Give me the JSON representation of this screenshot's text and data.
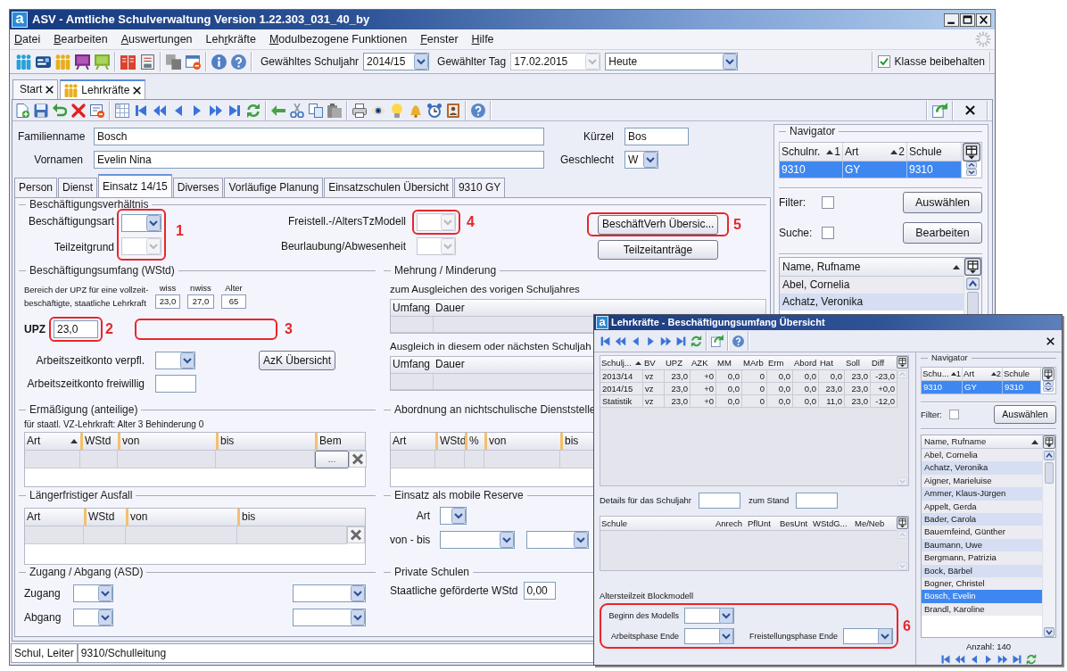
{
  "window": {
    "logo": "a",
    "title": "ASV - Amtliche Schulverwaltung Version 1.22.303_031_40_by"
  },
  "menu": [
    {
      "key": "D",
      "rest": "atei"
    },
    {
      "key": "B",
      "rest": "earbeiten"
    },
    {
      "key": "A",
      "rest": "uswertungen"
    },
    {
      "lead": "Leh",
      "key": "r",
      "rest": "kräfte"
    },
    {
      "key": "M",
      "rest": "odulbezogene Funktionen"
    },
    {
      "key": "F",
      "rest": "enster"
    },
    {
      "key": "H",
      "rest": "ilfe"
    }
  ],
  "toolbar": {
    "school_year": {
      "label": "Gewähltes Schuljahr",
      "value": "2014/15",
      "disabled": false
    },
    "day": {
      "label": "Gewählter Tag",
      "value": "17.02.2015",
      "disabled": true
    },
    "day_mode": {
      "value": "Heute",
      "disabled": false
    },
    "keep_class": {
      "label": "Klasse beibehalten",
      "checked": true
    }
  },
  "doc_tabs": [
    {
      "label": "Start",
      "kind": "plain",
      "selected": false
    },
    {
      "label": "Lehrkräfte",
      "kind": "module",
      "selected": true
    }
  ],
  "person": {
    "surname": {
      "label": "Familienname",
      "value": "Bosch"
    },
    "short_name": {
      "label": "Kürzel",
      "value": "Bos"
    },
    "first_names": {
      "label": "Vornamen",
      "value": "Evelin Nina"
    },
    "gender": {
      "label": "Geschlecht",
      "value": "W",
      "disabled": false
    }
  },
  "tabs": [
    {
      "label": "Person",
      "selected": false
    },
    {
      "label": "Dienst",
      "selected": false
    },
    {
      "label": "Einsatz 14/15",
      "selected": true
    },
    {
      "label": "Diverses",
      "selected": false
    },
    {
      "label": "Vorläufige Planung",
      "selected": false
    },
    {
      "label": "Einsatzschulen Übersicht",
      "selected": false
    },
    {
      "label": "9310 GY",
      "selected": false
    }
  ],
  "employment": {
    "title": "Beschäftigungsverhältnis",
    "left_fields": [
      {
        "label": "Beschäftigungsart",
        "disabled": false
      },
      {
        "label": "Teilzeitgrund",
        "disabled": true
      }
    ],
    "left_annotation": "1",
    "model_field": {
      "label": "Freistell.-/AltersTzModell",
      "disabled": true
    },
    "model_annotation": "4",
    "leave_field": {
      "label": "Beurlaubung/Abwesenheit",
      "disabled": true
    },
    "overview_button": {
      "label": "BeschäftVerh Übersic...",
      "annotation": "5"
    },
    "requests_button": {
      "label": "Teilzeitanträge"
    }
  },
  "scope": {
    "title": "Beschäftigungsumfang (WStd)",
    "note": "Bereich der UPZ für eine vollzeit-beschäftigte, staatliche Lehrkraft",
    "limits": [
      {
        "label": "wiss",
        "value": "23,0"
      },
      {
        "label": "nwiss",
        "value": "27,0"
      },
      {
        "label": "Alter",
        "value": "65"
      }
    ],
    "upz": {
      "label": "UPZ",
      "value": "23,0",
      "annotation": "2"
    },
    "blank_annotation": "3",
    "account_mandatory": {
      "label": "Arbeitszeitkonto verpfl.",
      "disabled": false
    },
    "account_button": {
      "label": "AzK Übersicht"
    },
    "account_voluntary": {
      "label": "Arbeitszeitkonto freiwillig"
    }
  },
  "adjustment": {
    "title": "Mehrung / Minderung",
    "tables": [
      {
        "caption": "zum Ausgleichen des vorigen Schuljahres",
        "columns": [
          "Umfang",
          "Dauer"
        ]
      },
      {
        "caption": "Ausgleich in diesem oder nächsten Schuljah",
        "columns": [
          "Umfang",
          "Dauer"
        ]
      }
    ]
  },
  "reduction": {
    "title": "Ermäßigung (anteilige)",
    "note": "für staatl. VZ-Lehrkraft: Alter 3 Behinderung 0",
    "columns": [
      {
        "label": "Art",
        "sorted": true
      },
      {
        "label": "WStd",
        "sorted": false
      },
      {
        "label": "von",
        "sorted": false
      },
      {
        "label": "bis",
        "sorted": false
      },
      {
        "label": "Bem",
        "sorted": false
      }
    ],
    "more_button": "..."
  },
  "secondment": {
    "title": "Abordnung an nichtschulische Dienststelle",
    "columns": [
      "Art",
      "WStd",
      "%",
      "von",
      "bis"
    ]
  },
  "absence": {
    "title": "Längerfristiger Ausfall",
    "columns": [
      "Art",
      "WStd",
      "von",
      "bis"
    ]
  },
  "reserve": {
    "title": "Einsatz als mobile Reserve",
    "type_label": "Art",
    "range_label": "von - bis"
  },
  "transfer": {
    "title": "Zugang / Abgang (ASD)",
    "rows": [
      "Zugang",
      "Abgang"
    ]
  },
  "private_schools": {
    "title": "Private Schulen",
    "label": "Staatliche geförderte WStd",
    "value": "0,00"
  },
  "navigator": {
    "title": "Navigator",
    "school_columns": [
      {
        "label": "Schulnr.",
        "sort": "1"
      },
      {
        "label": "Art",
        "sort": "2"
      },
      {
        "label": "Schule"
      }
    ],
    "school_rows": [
      {
        "cells": [
          "9310",
          "GY",
          "9310"
        ],
        "selected": true
      }
    ],
    "filter": {
      "label": "Filter:",
      "checked": false
    },
    "select_button": "Auswählen",
    "search": {
      "label": "Suche:",
      "checked": false
    },
    "edit_button": "Bearbeiten",
    "list_header": "Name, Rufname",
    "people": [
      {
        "name": "Abel, Cornelia",
        "selected": false
      },
      {
        "name": "Achatz, Veronika",
        "selected": false
      }
    ]
  },
  "status_bar": [
    "Schul, Leiter",
    "9310/Schulleitung"
  ],
  "popup": {
    "logo": "a",
    "title": "Lehrkräfte - Beschäftigungsumfang Übersicht",
    "columns": [
      {
        "label": "Schulj...",
        "sorted": true
      },
      {
        "label": "BV",
        "sorted": false
      },
      {
        "label": "UPZ",
        "sorted": false
      },
      {
        "label": "AZK",
        "sorted": false
      },
      {
        "label": "MM",
        "sorted": false
      },
      {
        "label": "MArb",
        "sorted": false
      },
      {
        "label": "Erm",
        "sorted": false
      },
      {
        "label": "Abord",
        "sorted": false
      },
      {
        "label": "Hat",
        "sorted": false
      },
      {
        "label": "Soll",
        "sorted": false
      },
      {
        "label": "Diff",
        "sorted": false
      }
    ],
    "rows": [
      [
        "2013/14",
        "vz",
        "23,0",
        "+0",
        "0,0",
        "0",
        "0,0",
        "0,0",
        "0,0",
        "23,0",
        "-23,0"
      ],
      [
        "2014/15",
        "vz",
        "23,0",
        "+0",
        "0,0",
        "0",
        "0,0",
        "0,0",
        "23,0",
        "23,0",
        "+0,0"
      ],
      [
        "Statistik",
        "vz",
        "23,0",
        "+0",
        "0,0",
        "0",
        "0,0",
        "0,0",
        "11,0",
        "23,0",
        "-12,0"
      ]
    ],
    "details_label": "Details für das Schuljahr",
    "stand_label": "zum Stand",
    "school_columns": [
      "Schule",
      "Anrech",
      "PflUnt",
      "BesUnt",
      "WStdG...",
      "Me/Neb"
    ],
    "block_model": {
      "title": "Altersteilzeit Blockmodell",
      "annotation": "6",
      "fields": [
        {
          "label": "Beginn des Modells"
        },
        {
          "label": "Arbeitsphase Ende"
        },
        {
          "label": "Freistellungsphase Ende"
        }
      ]
    },
    "navigator": {
      "title": "Navigator",
      "school_columns": [
        {
          "label": "Schu...",
          "sort": "1"
        },
        {
          "label": "Art",
          "sort": "2"
        },
        {
          "label": "Schule"
        }
      ],
      "school_rows": [
        {
          "cells": [
            "9310",
            "GY",
            "9310"
          ],
          "selected": true
        }
      ],
      "filter": {
        "label": "Filter:",
        "checked": false
      },
      "select_button": "Auswählen",
      "list_header": "Name, Rufname",
      "people": [
        {
          "name": "Abel, Cornelia",
          "selected": false
        },
        {
          "name": "Achatz, Veronika",
          "selected": false
        },
        {
          "name": "Aigner, Marieluise",
          "selected": false
        },
        {
          "name": "Ammer, Klaus-Jürgen",
          "selected": false
        },
        {
          "name": "Appelt, Gerda",
          "selected": false
        },
        {
          "name": "Bader, Carola",
          "selected": false
        },
        {
          "name": "Bauernfeind, Günther",
          "selected": false
        },
        {
          "name": "Baumann, Uwe",
          "selected": false
        },
        {
          "name": "Bergmann, Patrizia",
          "selected": false
        },
        {
          "name": "Bock, Bärbel",
          "selected": false
        },
        {
          "name": "Bogner, Christel",
          "selected": false
        },
        {
          "name": "Bosch, Evelin",
          "selected": true
        },
        {
          "name": "Brandl, Karoline",
          "selected": false
        }
      ],
      "count": "Anzahl: 140"
    }
  }
}
